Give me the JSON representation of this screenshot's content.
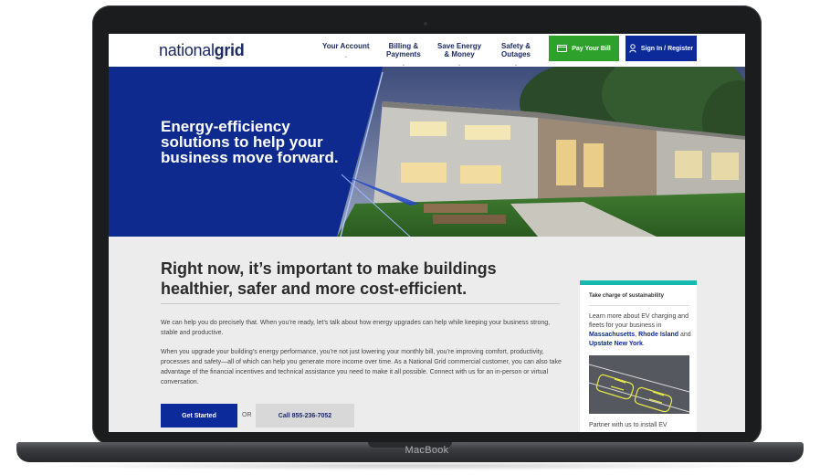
{
  "device": {
    "label": "MacBook"
  },
  "header": {
    "logo": {
      "light": "national",
      "bold": "grid"
    },
    "nav": [
      {
        "line1": "Your Account",
        "line2": ""
      },
      {
        "line1": "Billing &",
        "line2": "Payments"
      },
      {
        "line1": "Save Energy",
        "line2": "& Money"
      },
      {
        "line1": "Safety &",
        "line2": "Outages"
      }
    ],
    "pay_bill": {
      "label": "Pay Your Bill",
      "icon": "credit-card-icon",
      "color": "#2ea12c"
    },
    "sign_in": {
      "label": "Sign In / Register",
      "icon": "user-icon",
      "color": "#0c2a99"
    }
  },
  "hero": {
    "title": "Energy-efficiency solutions to help your business move forward.",
    "accent_color": "#0f2a8e"
  },
  "main": {
    "heading": "Right now, it’s important to make buildings healthier, safer and more cost-efficient.",
    "paragraphs": [
      "We can help you do precisely that. When you’re ready, let’s talk about how energy upgrades can help while keeping your business strong, stable and productive.",
      "When you upgrade your building’s energy performance, you’re not just lowering your monthly bill, you’re improving comfort, productivity, processes and safety—all of which can help you generate more income over time.  As a National Grid commercial customer, you can also take advantage of the financial incentives and technical assistance you need to make it all possible.  Connect with us for an in-person or virtual conversation."
    ],
    "cta_primary": "Get Started",
    "cta_or": "OR",
    "cta_secondary": "Call 855-236-7052"
  },
  "sidebar": {
    "title": "Take charge of sustainability",
    "text_before": "Learn more about EV charging and fleets for your business in ",
    "link1": "Massachusetts",
    "sep1": ", ",
    "link2": "Rhode Island",
    "sep2": " and ",
    "link3": "Upstate New York",
    "text_after": ".",
    "footer_text": "Partner with us to install EV",
    "accent_color": "#15b9b0"
  }
}
